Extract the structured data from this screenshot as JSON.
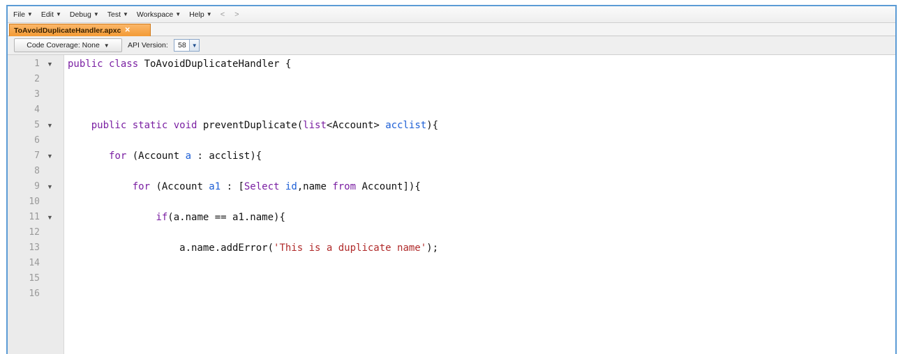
{
  "menu": {
    "items": [
      {
        "label": "File"
      },
      {
        "label": "Edit"
      },
      {
        "label": "Debug"
      },
      {
        "label": "Test"
      },
      {
        "label": "Workspace"
      },
      {
        "label": "Help"
      }
    ],
    "back_arrow": "<",
    "forward_arrow": ">"
  },
  "tab": {
    "label": "ToAvoidDuplicateHandler.apxc",
    "close_glyph": "✕"
  },
  "toolbar": {
    "coverage_label": "Code Coverage: None",
    "api_label": "API Version:",
    "api_value": "58"
  },
  "code": {
    "line_numbers": [
      "1",
      "2",
      "3",
      "4",
      "5",
      "6",
      "7",
      "8",
      "9",
      "10",
      "11",
      "12",
      "13",
      "14",
      "15",
      "16"
    ],
    "fold_lines": [
      "1",
      "5",
      "7",
      "9",
      "11"
    ],
    "lines": [
      [
        {
          "t": "kw",
          "v": "public class "
        },
        {
          "t": "plain",
          "v": "ToAvoidDuplicateHandler {"
        }
      ],
      [],
      [],
      [],
      [
        {
          "t": "plain",
          "v": "    "
        },
        {
          "t": "kw",
          "v": "public static void "
        },
        {
          "t": "plain",
          "v": "preventDuplicate("
        },
        {
          "t": "kw",
          "v": "list"
        },
        {
          "t": "plain",
          "v": "<Account> "
        },
        {
          "t": "var",
          "v": "acclist"
        },
        {
          "t": "plain",
          "v": "){"
        }
      ],
      [],
      [
        {
          "t": "plain",
          "v": "       "
        },
        {
          "t": "kw",
          "v": "for "
        },
        {
          "t": "plain",
          "v": "(Account "
        },
        {
          "t": "var",
          "v": "a"
        },
        {
          "t": "plain",
          "v": " : acclist){"
        }
      ],
      [],
      [
        {
          "t": "plain",
          "v": "           "
        },
        {
          "t": "kw",
          "v": "for "
        },
        {
          "t": "plain",
          "v": "(Account "
        },
        {
          "t": "var",
          "v": "a1"
        },
        {
          "t": "plain",
          "v": " : ["
        },
        {
          "t": "kw",
          "v": "Select "
        },
        {
          "t": "var",
          "v": "id"
        },
        {
          "t": "plain",
          "v": ",name "
        },
        {
          "t": "kw",
          "v": "from "
        },
        {
          "t": "plain",
          "v": "Account]){"
        }
      ],
      [],
      [
        {
          "t": "plain",
          "v": "               "
        },
        {
          "t": "kw",
          "v": "if"
        },
        {
          "t": "plain",
          "v": "(a.name == a1.name){"
        }
      ],
      [],
      [
        {
          "t": "plain",
          "v": "                   a.name.addError("
        },
        {
          "t": "str",
          "v": "'This is a duplicate name'"
        },
        {
          "t": "plain",
          "v": ");"
        }
      ],
      [],
      [],
      []
    ]
  }
}
